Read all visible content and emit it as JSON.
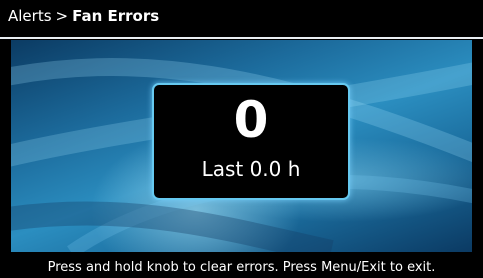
{
  "header": {
    "crumb_parent": "Alerts",
    "crumb_separator": ">",
    "crumb_current": "Fan Errors"
  },
  "counter": {
    "value": "0",
    "last_label": "Last 0.0 h"
  },
  "footer": {
    "instruction": "Press and hold knob to clear errors.  Press Menu/Exit to exit."
  },
  "colors": {
    "background": "#000000",
    "screen_accent": "#2b8ec0",
    "box_border": "#66c9f0",
    "text": "#ffffff"
  }
}
